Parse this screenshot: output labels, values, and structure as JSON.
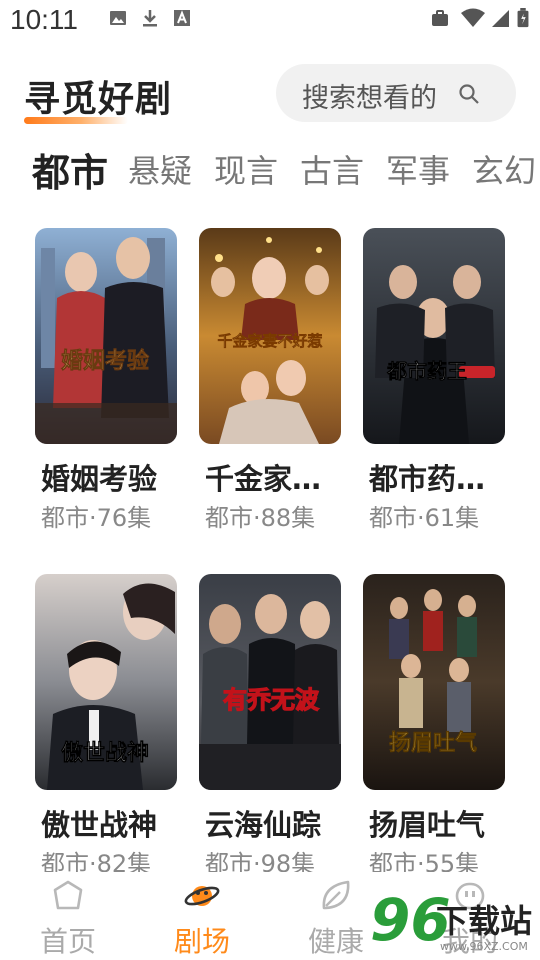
{
  "status_bar": {
    "time": "10:11",
    "left_icons": [
      "image-icon",
      "download-icon",
      "text-icon"
    ],
    "right_icons": [
      "briefcase-icon",
      "wifi-icon",
      "signal-icon",
      "battery-icon"
    ]
  },
  "header": {
    "title": "寻觅好剧",
    "accent_color": "#ff8a1a",
    "search": {
      "text": "搜索想看的"
    }
  },
  "tabs": [
    {
      "label": "都市",
      "active": true
    },
    {
      "label": "悬疑",
      "active": false
    },
    {
      "label": "现言",
      "active": false
    },
    {
      "label": "古言",
      "active": false
    },
    {
      "label": "军事",
      "active": false
    },
    {
      "label": "玄幻",
      "active": false
    }
  ],
  "dramas": [
    {
      "title": "婚姻考验",
      "meta": "都市·76集",
      "poster_text": "婚姻考验"
    },
    {
      "title": "千金家…",
      "meta": "都市·88集",
      "poster_text": "千金家妻不好惹"
    },
    {
      "title": "都市药…",
      "meta": "都市·61集",
      "poster_text": "都市药王"
    },
    {
      "title": "傲世战神",
      "meta": "都市·82集",
      "poster_text": "傲世战神"
    },
    {
      "title": "云海仙踪",
      "meta": "都市·98集",
      "poster_text": "有乔无波"
    },
    {
      "title": "扬眉吐气",
      "meta": "都市·55集",
      "poster_text": "扬眉吐气"
    }
  ],
  "bottom_nav": [
    {
      "label": "首页",
      "icon": "home-icon",
      "active": false
    },
    {
      "label": "剧场",
      "icon": "planet-icon",
      "active": true
    },
    {
      "label": "健康",
      "icon": "leaf-icon",
      "active": false
    },
    {
      "label": "我的",
      "icon": "profile-icon",
      "active": false
    }
  ],
  "watermark": {
    "number": "96",
    "text": "下载站",
    "url": "www.96XZ.COM"
  }
}
